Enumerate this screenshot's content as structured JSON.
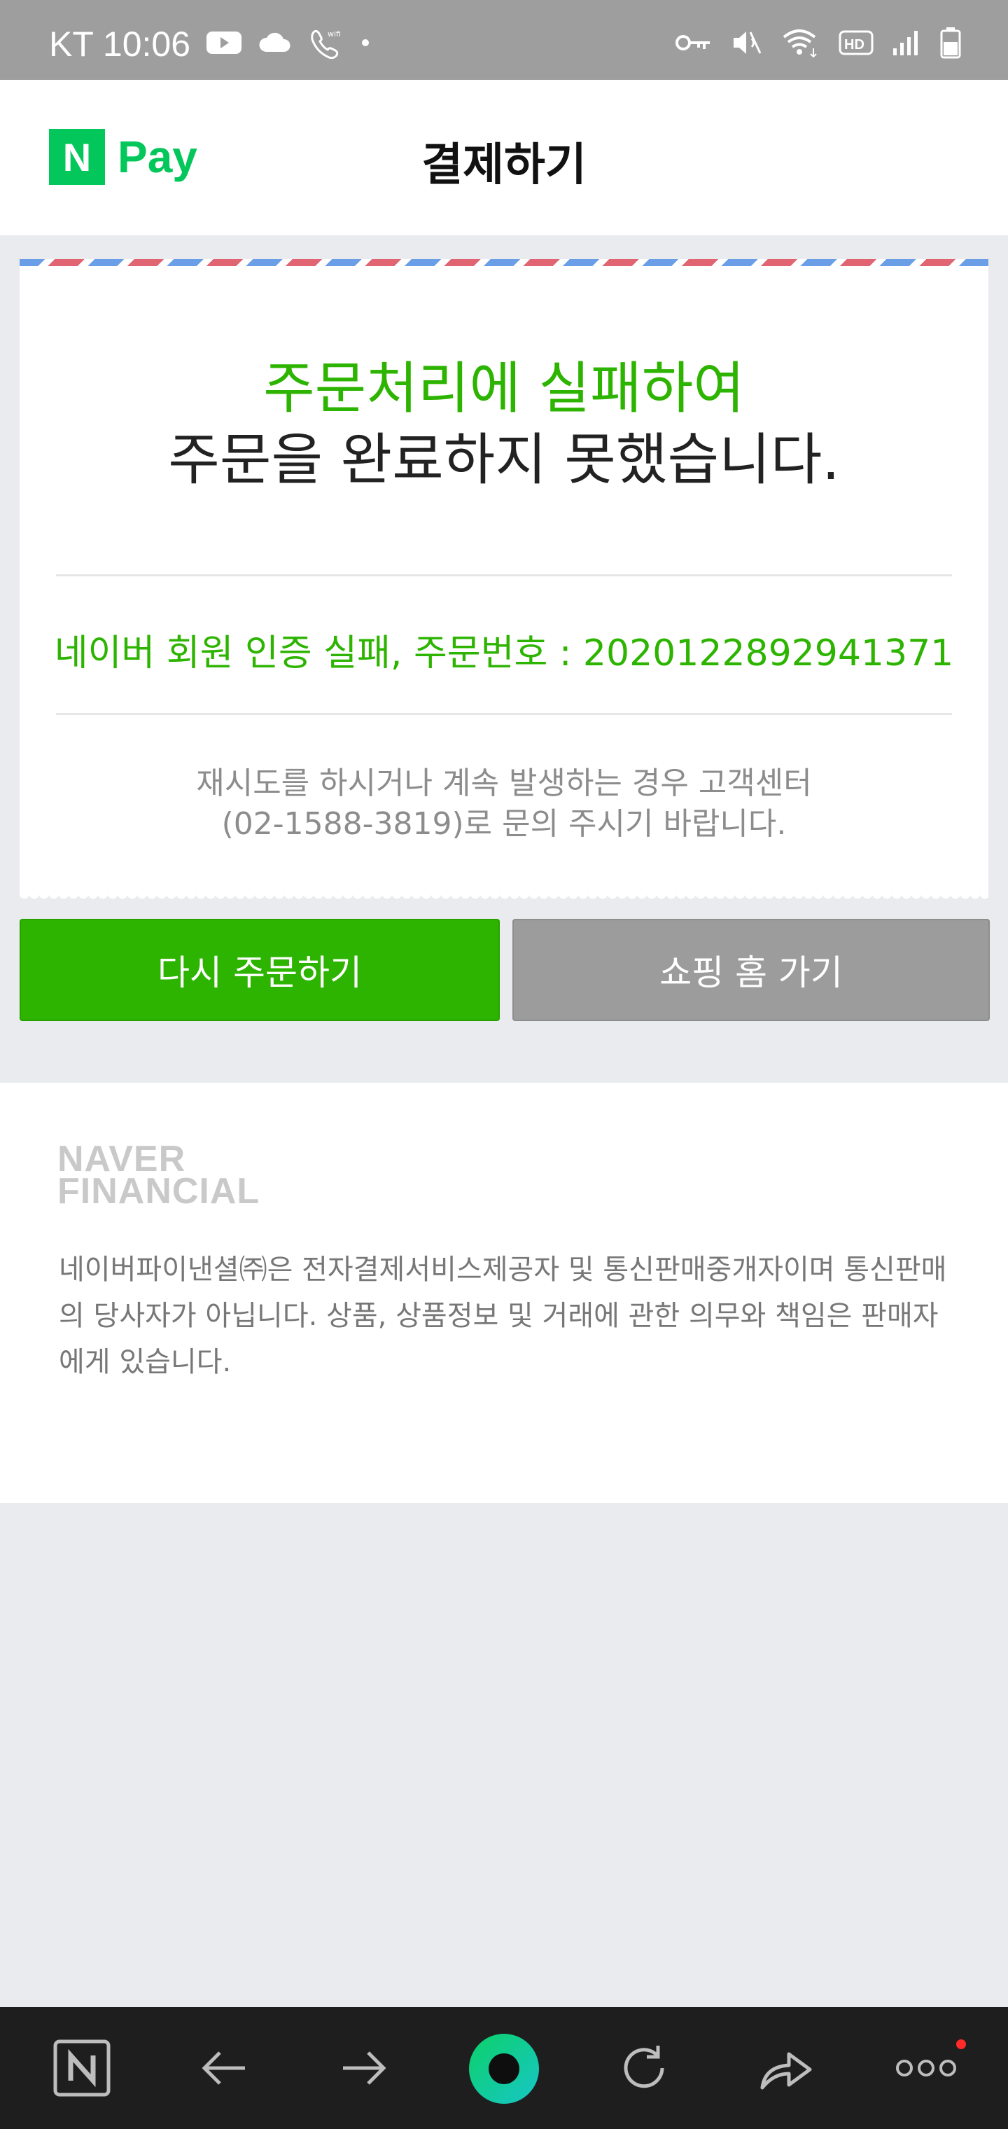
{
  "status_bar": {
    "carrier_time": "KT 10:06",
    "left_icons": [
      "youtube-icon",
      "cloud-icon",
      "wifi-call-icon",
      "dot-icon"
    ],
    "right_icons": [
      "key-icon",
      "mute-icon",
      "wifi-icon",
      "hd-icon",
      "signal-icon",
      "battery-icon"
    ]
  },
  "header": {
    "logo_mark": "N",
    "logo_text": "Pay",
    "title": "결제하기"
  },
  "result": {
    "headline_line1": "주문처리에 실패하여",
    "headline_line2": "주문을 완료하지 못했습니다.",
    "failure_detail": "네이버 회원 인증 실패, 주문번호 : 2020122892941371",
    "hint_line1": "재시도를 하시거나 계속 발생하는 경우 고객센터",
    "hint_line2": "(02-1588-3819)로 문의 주시기 바랍니다."
  },
  "actions": {
    "retry_label": "다시 주문하기",
    "shopping_home_label": "쇼핑 홈 가기"
  },
  "footer": {
    "brand_line1": "NAVER",
    "brand_line2": "FINANCIAL",
    "disclaimer": "네이버파이낸셜㈜은 전자결제서비스제공자 및 통신판매중개자이며 통신판매의 당사자가 아닙니다. 상품, 상품정보 및 거래에 관한 의무와 책임은 판매자에게 있습니다."
  },
  "browser_bar": {
    "items": [
      "naver-home-icon",
      "back-arrow-icon",
      "forward-arrow-icon",
      "green-dot-icon",
      "refresh-icon",
      "share-icon",
      "more-icon"
    ]
  },
  "colors": {
    "naver_green": "#03c75a",
    "success_green": "#2db400",
    "neutral_button": "#9c9c9c"
  }
}
